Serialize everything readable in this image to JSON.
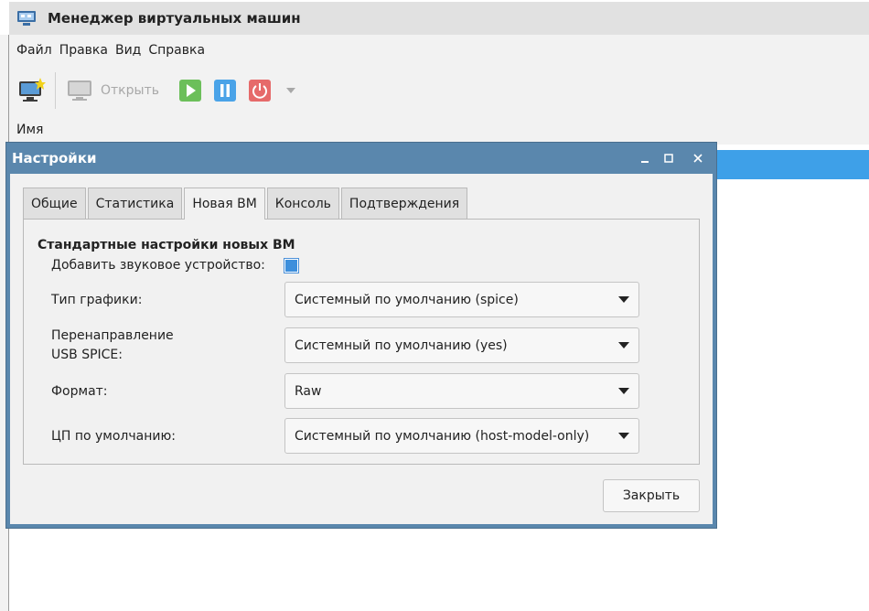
{
  "main_window": {
    "title": "Менеджер виртуальных машин",
    "menu": [
      "Файл",
      "Правка",
      "Вид",
      "Справка"
    ],
    "toolbar": {
      "open_label": "Открыть",
      "icons": [
        "new-vm-icon",
        "monitor-icon",
        "play-icon",
        "pause-icon",
        "power-icon",
        "dropdown-arrow-icon"
      ]
    },
    "list_header": "Имя",
    "colors": {
      "selection": "#3ea0e8",
      "run": "#5cb85c",
      "pause": "#4aa3e8",
      "power": "#e66a6a"
    }
  },
  "dialog": {
    "title": "Настройки",
    "tabs": [
      "Общие",
      "Статистика",
      "Новая ВМ",
      "Консоль",
      "Подтверждения"
    ],
    "active_tab": "Новая ВМ",
    "section_title": "Стандартные настройки новых ВМ",
    "sound": {
      "label": "Добавить звуковое устройство:",
      "checked": true
    },
    "graphics": {
      "label": "Тип графики:",
      "value": "Системный по умолчанию (spice)"
    },
    "usb": {
      "label_line1": "Перенаправление",
      "label_line2": "USB SPICE:",
      "value": "Системный по умолчанию (yes)"
    },
    "format": {
      "label": "Формат:",
      "value": "Raw"
    },
    "cpu": {
      "label": "ЦП по умолчанию:",
      "value": "Системный по умолчанию (host-model-only)"
    },
    "close_label": "Закрыть",
    "colors": {
      "titlebar": "#5a87ad",
      "checkbox": "#3d8fdc"
    }
  }
}
